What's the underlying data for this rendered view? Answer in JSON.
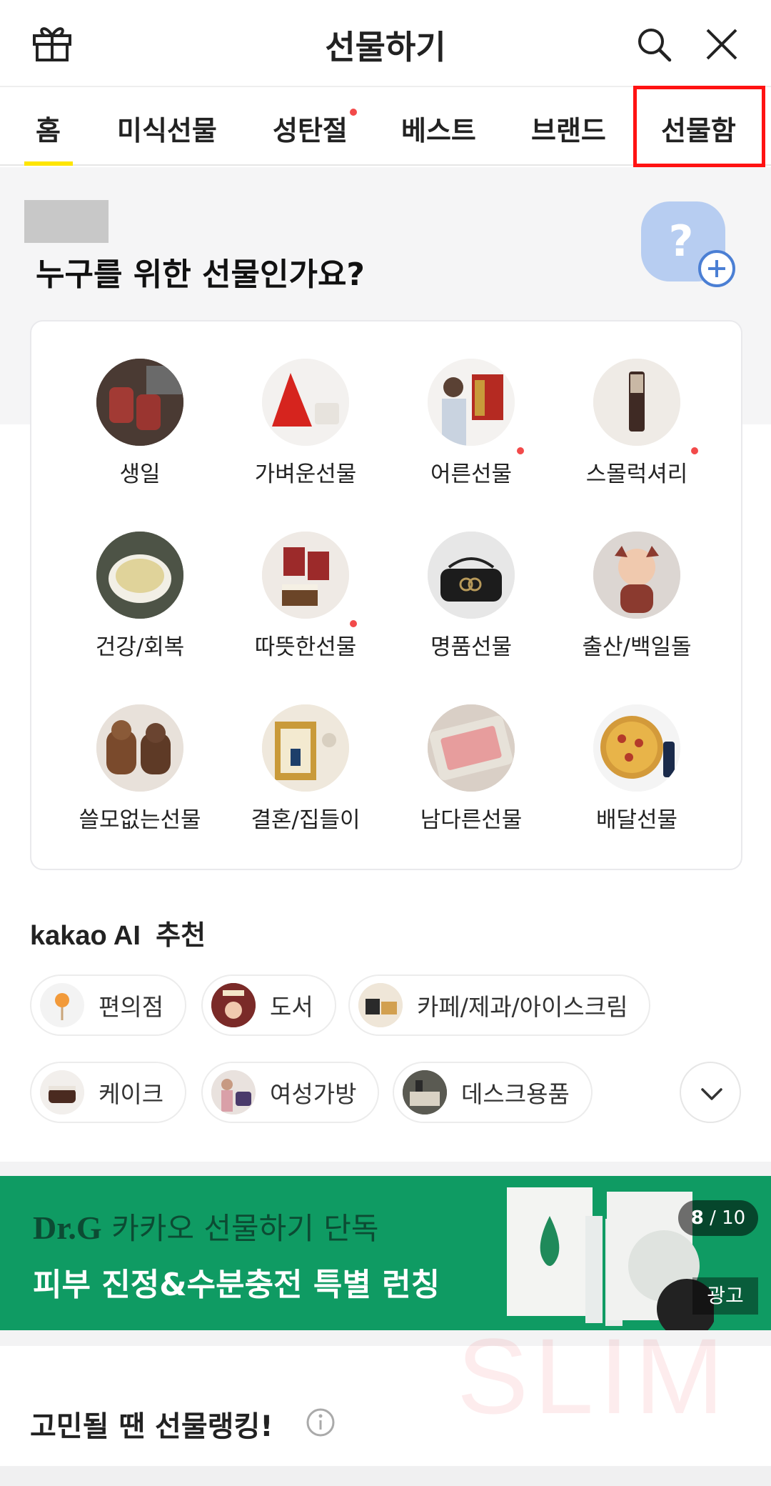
{
  "header": {
    "title": "선물하기"
  },
  "tabs": [
    {
      "label": "홈"
    },
    {
      "label": "미식선물"
    },
    {
      "label": "성탄절"
    },
    {
      "label": "베스트"
    },
    {
      "label": "브랜드"
    },
    {
      "label": "선물함"
    }
  ],
  "hero": {
    "question": "누구를 위한 선물인가요?"
  },
  "categories": [
    {
      "label": "생일"
    },
    {
      "label": "가벼운선물"
    },
    {
      "label": "어른선물"
    },
    {
      "label": "스몰럭셔리"
    },
    {
      "label": "건강/회복"
    },
    {
      "label": "따뜻한선물"
    },
    {
      "label": "명품선물"
    },
    {
      "label": "출산/백일돌"
    },
    {
      "label": "쓸모없는선물"
    },
    {
      "label": "결혼/집들이"
    },
    {
      "label": "남다른선물"
    },
    {
      "label": "배달선물"
    }
  ],
  "ai": {
    "brand": "kakao AI",
    "suffix": "추천",
    "chips": [
      {
        "label": "편의점"
      },
      {
        "label": "도서"
      },
      {
        "label": "카페/제과/아이스크림"
      },
      {
        "label": "케이크"
      },
      {
        "label": "여성가방"
      },
      {
        "label": "데스크용품"
      }
    ]
  },
  "banner": {
    "brand": "Dr.G",
    "line1": "카카오 선물하기 단독",
    "line2": "피부 진정&수분충전 특별 런칭",
    "counter_current": "8",
    "counter_sep": " / ",
    "counter_total": "10",
    "ad_label": "광고",
    "bg_color": "#0f9b63"
  },
  "ranking": {
    "title": "고민될 땐 선물랭킹!"
  },
  "colors": {
    "accent": "#FEE500",
    "highlight": "#ff1212",
    "notify": "#f24a4a"
  },
  "watermark": "SLIM"
}
